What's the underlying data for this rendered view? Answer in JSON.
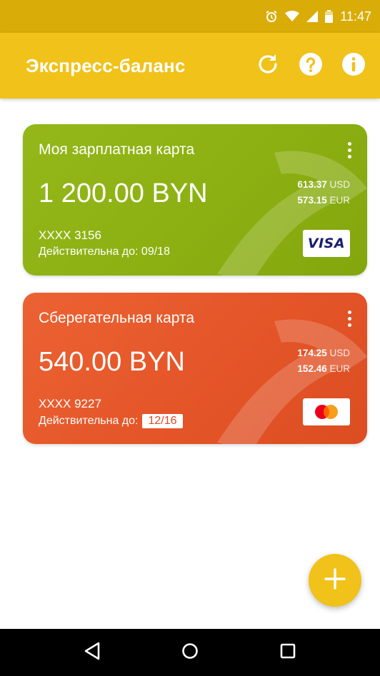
{
  "status_bar": {
    "time": "11:47",
    "icons": [
      "alarm-icon",
      "wifi-icon",
      "signal-icon",
      "battery-icon"
    ]
  },
  "app_bar": {
    "title": "Экспресс-баланс",
    "actions": [
      "refresh-icon",
      "help-icon",
      "info-icon"
    ]
  },
  "cards": [
    {
      "name": "Моя зарплатная карта",
      "balance": "1 200.00 BYN",
      "rate_usd_value": "613.37",
      "rate_usd_currency": "USD",
      "rate_eur_value": "573.15",
      "rate_eur_currency": "EUR",
      "number": "XXXX 3156",
      "expiry_label": "Действительна до: 09/18",
      "brand": "VISA",
      "color": "#8cb012"
    },
    {
      "name": "Сберегательная карта",
      "balance": "540.00 BYN",
      "rate_usd_value": "174.25",
      "rate_usd_currency": "USD",
      "rate_eur_value": "152.46",
      "rate_eur_currency": "EUR",
      "number": "XXXX 9227",
      "expiry_label": "Действительна до:",
      "expiry_value": "12/16",
      "brand": "mastercard",
      "color": "#e45528"
    }
  ],
  "fab": {
    "icon": "plus-icon"
  },
  "nav_bar": {
    "buttons": [
      "back-icon",
      "home-icon",
      "recents-icon"
    ]
  },
  "colors": {
    "status_bar": "#d9ac08",
    "app_bar": "#f0c21a",
    "fab": "#f0c21a",
    "card_green": "#8cb012",
    "card_orange": "#e45528"
  }
}
